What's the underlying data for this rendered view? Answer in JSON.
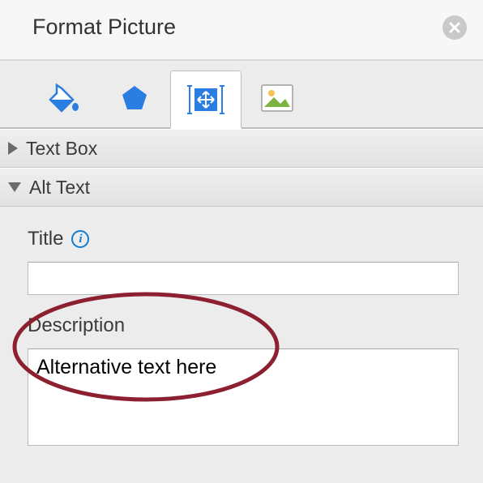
{
  "header": {
    "title": "Format Picture"
  },
  "sections": {
    "text_box": {
      "label": "Text Box",
      "expanded": false
    },
    "alt_text": {
      "label": "Alt Text",
      "expanded": true
    }
  },
  "alt_text_panel": {
    "title_label": "Title",
    "title_value": "",
    "description_label": "Description",
    "description_value": "Alternative text here"
  },
  "tabs": {
    "active_index": 2,
    "items": [
      {
        "name": "fill-line-icon"
      },
      {
        "name": "effects-icon"
      },
      {
        "name": "size-properties-icon"
      },
      {
        "name": "picture-icon"
      }
    ]
  },
  "annotation": {
    "ellipse_color": "#8c2030"
  }
}
